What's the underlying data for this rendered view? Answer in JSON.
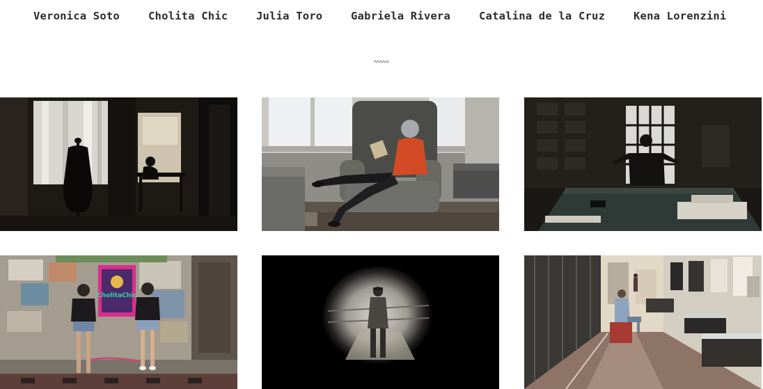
{
  "nav": {
    "items": [
      {
        "label": "Veronica Soto"
      },
      {
        "label": "Cholita Chic"
      },
      {
        "label": "Julia Toro"
      },
      {
        "label": "Gabriela Rivera"
      },
      {
        "label": "Catalina de la Cruz"
      },
      {
        "label": "Kena Lorenzini"
      }
    ]
  },
  "divider_icon": "zigzag-divider-icon",
  "gallery": {
    "items": [
      {
        "subject": "dress-form-and-woman-writing-at-desk"
      },
      {
        "subject": "woman-reading-in-armchair"
      },
      {
        "subject": "figure-at-window-in-archive-room"
      },
      {
        "subject": "two-women-in-front-of-cholita-chic-poster",
        "sign_text": "CholitaChic"
      },
      {
        "subject": "person-in-vignette-on-bridge"
      },
      {
        "subject": "woman-seated-in-gallery-hall"
      }
    ]
  },
  "colors": {
    "nav_text": "#2b2b2b",
    "background": "#ffffff",
    "divider": "#8a8a8a"
  }
}
